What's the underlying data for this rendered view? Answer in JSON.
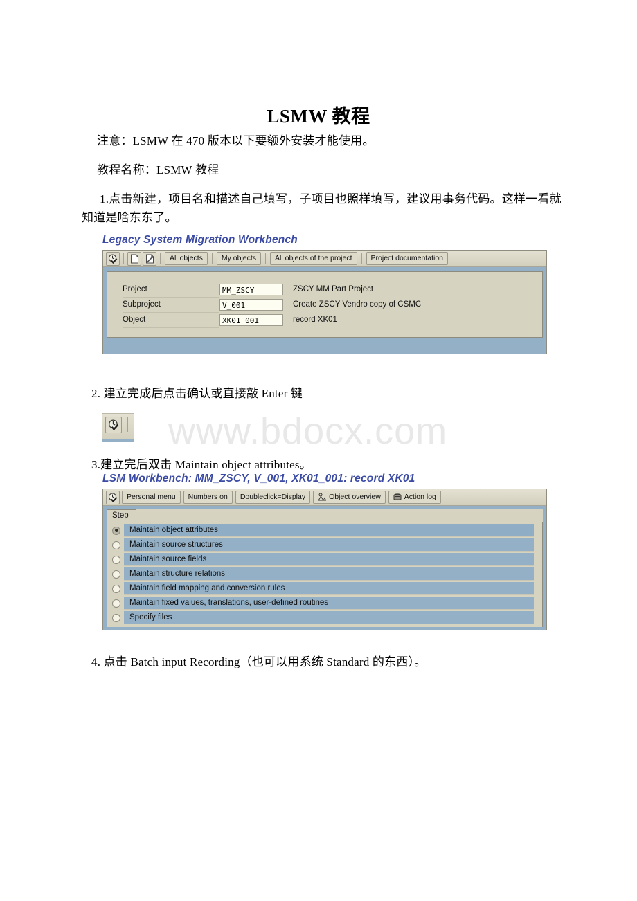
{
  "document": {
    "title": "LSMW 教程",
    "paragraphs": {
      "note": "注意：LSMW 在 470 版本以下要额外安装才能使用。",
      "tutorial_name": "教程名称：LSMW 教程",
      "step1": "1.点击新建，项目名和描述自己填写，子项目也照样填写，建议用事务代码。这样一看就知道是啥东东了。",
      "step2": "2. 建立完成后点击确认或直接敲 Enter 键",
      "step3": "3.建立完后双击 Maintain object attributes。",
      "step4": "4. 点击 Batch input Recording（也可以用系统 Standard 的东西）。"
    },
    "watermark": "www.bdocx.com"
  },
  "screenshot1": {
    "title": "Legacy System Migration Workbench",
    "toolbar": {
      "enter_icon": "enter-clock-check-icon",
      "new_icon": "new-document-icon",
      "edit_icon": "edit-pencil-icon",
      "buttons": [
        {
          "label": "All objects"
        },
        {
          "label": "My objects"
        },
        {
          "label": "All objects of the project"
        },
        {
          "label": "Project documentation"
        }
      ]
    },
    "form": {
      "rows": [
        {
          "label": "Project",
          "value": "MM_ZSCY",
          "description": "ZSCY MM Part Project"
        },
        {
          "label": "Subproject",
          "value": "V_001",
          "description": "Create ZSCY Vendro copy of CSMC"
        },
        {
          "label": "Object",
          "value": "XK01_001",
          "description": "record XK01"
        }
      ]
    }
  },
  "standalone_button": {
    "icon": "enter-clock-check-icon",
    "tooltip": "Enter"
  },
  "screenshot2": {
    "title": "LSM Workbench: MM_ZSCY, V_001, XK01_001: record XK01",
    "toolbar": {
      "enter_icon": "enter-clock-check-icon",
      "buttons": [
        {
          "label": "Personal menu",
          "icon": null
        },
        {
          "label": "Numbers on",
          "icon": null
        },
        {
          "label": "Doubleclick=Display",
          "icon": null
        },
        {
          "label": "Object overview",
          "icon": "person-overview-icon"
        },
        {
          "label": "Action log",
          "icon": "action-log-icon"
        }
      ]
    },
    "tab": {
      "label": "Step"
    },
    "steps": [
      {
        "label": "Maintain object attributes",
        "selected": true
      },
      {
        "label": "Maintain source structures",
        "selected": false
      },
      {
        "label": "Maintain source fields",
        "selected": false
      },
      {
        "label": "Maintain structure relations",
        "selected": false
      },
      {
        "label": "Maintain field mapping and conversion rules",
        "selected": false
      },
      {
        "label": "Maintain fixed values, translations, user-defined routines",
        "selected": false
      },
      {
        "label": "Specify files",
        "selected": false
      }
    ]
  },
  "colors": {
    "sap_title_blue": "#3b4ba4",
    "sap_panel_beige": "#d6d3c1",
    "sap_body_blue": "#93b0c6",
    "sap_input_bg": "#fdfdf2",
    "watermark_gray": "#e8e8e8"
  }
}
